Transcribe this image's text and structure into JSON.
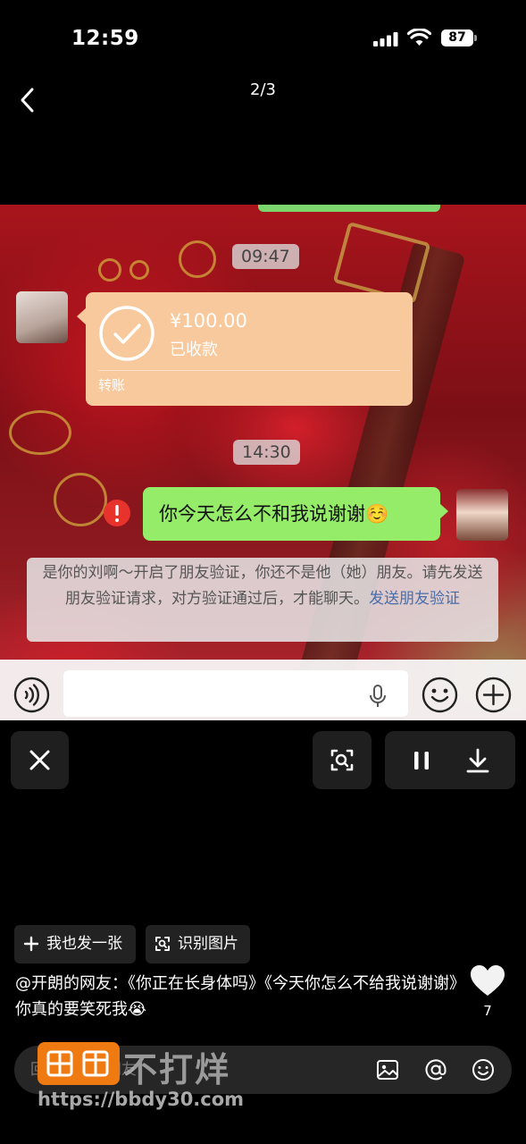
{
  "status": {
    "time": "12:59",
    "battery": "87"
  },
  "nav": {
    "page_indicator": "2/3"
  },
  "chat": {
    "timestamp_1": "09:47",
    "transfer_amount": "¥100.00",
    "transfer_status": "已收款",
    "transfer_label": "转账",
    "timestamp_2": "14:30",
    "message": "你今天怎么不和我说谢谢☺️",
    "system_notice": "是你的刘啊～开启了朋友验证，你还不是他（她）朋友。请先发送朋友验证请求，对方验证通过后，才能聊天。",
    "system_link": "发送朋友验证"
  },
  "actions": {
    "post_label": "我也发一张",
    "ocr_label": "识别图片"
  },
  "caption": "@开朗的网友：《你正在长身体吗》《今天你怎么不给我说谢谢》你真的要笑死我😭",
  "likes": "7",
  "comment": {
    "placeholder": "回复开朗的网友"
  },
  "watermark": {
    "text": "不打烊",
    "url": "https://bbdy30.com"
  }
}
